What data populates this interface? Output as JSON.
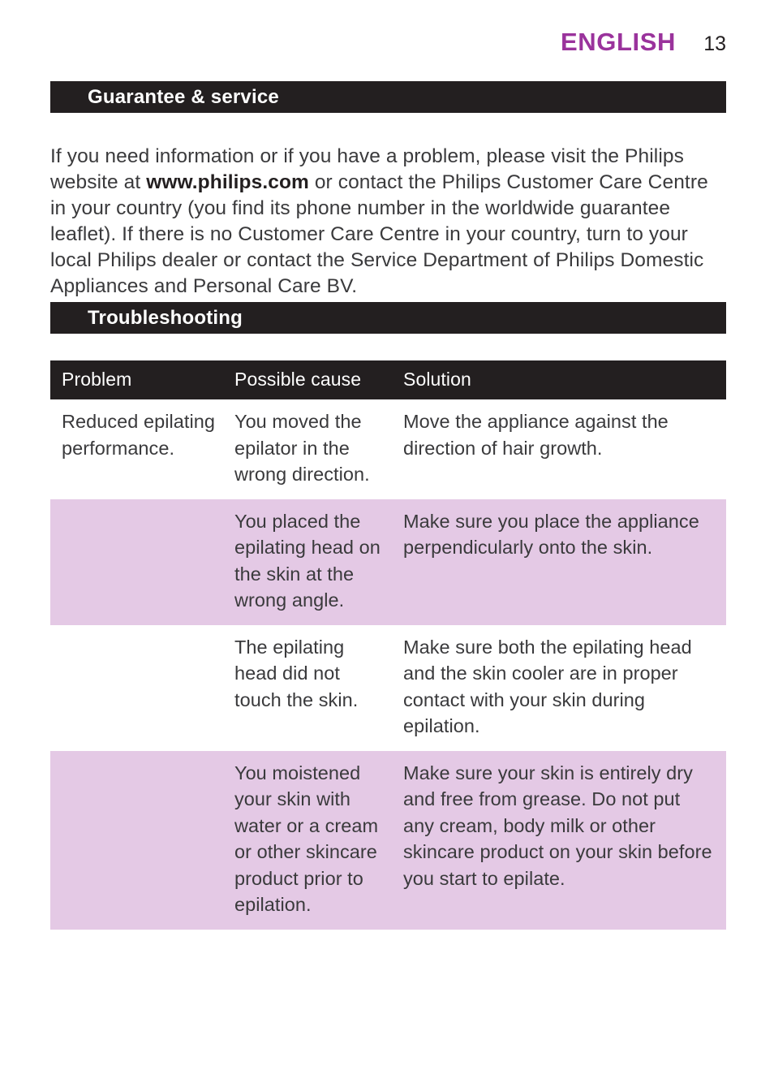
{
  "running_head": {
    "language": "ENGLISH",
    "page_number": "13",
    "accent_color": "#9a339c"
  },
  "sections": {
    "guarantee": {
      "title": "Guarantee & service",
      "paragraph_part1": "If you need information or if you have a problem, please visit the Philips website at ",
      "paragraph_bold": "www.philips.com",
      "paragraph_part2": " or contact the Philips Customer Care Centre in your country (you find its phone number in the worldwide guarantee leaflet). If there is no Customer Care Centre in your country, turn to your local Philips dealer or contact the Service Department of Philips Domestic Appliances and Personal Care BV."
    },
    "troubleshooting": {
      "title": "Troubleshooting"
    }
  },
  "table": {
    "headers": {
      "problem": "Problem",
      "possible_cause": "Possible cause",
      "solution": "Solution"
    },
    "rows": [
      {
        "shaded": false,
        "problem": "Reduced epilating performance.",
        "possible_cause": "You moved the epilator in the wrong direction.",
        "solution": "Move the appliance against the direction of hair growth."
      },
      {
        "shaded": true,
        "problem": "",
        "possible_cause": "You placed the epilating head on the skin at the wrong angle.",
        "solution": "Make sure you place the appliance perpendicularly onto the skin."
      },
      {
        "shaded": false,
        "problem": "",
        "possible_cause": "The epilating head did not touch the skin.",
        "solution": "Make sure both the epilating head and the skin cooler are in proper contact with your skin during epilation."
      },
      {
        "shaded": true,
        "problem": "",
        "possible_cause": "You moistened your skin with water or a cream or other skincare product prior to epilation.",
        "solution": "Make sure your skin is entirely dry and free from grease. Do not put any cream, body milk or other skincare product on your skin before you start to epilate."
      }
    ]
  },
  "colors": {
    "bar_background": "#231f20",
    "row_shaded": "#e4c9e5",
    "body_text": "#3a3a3c"
  }
}
